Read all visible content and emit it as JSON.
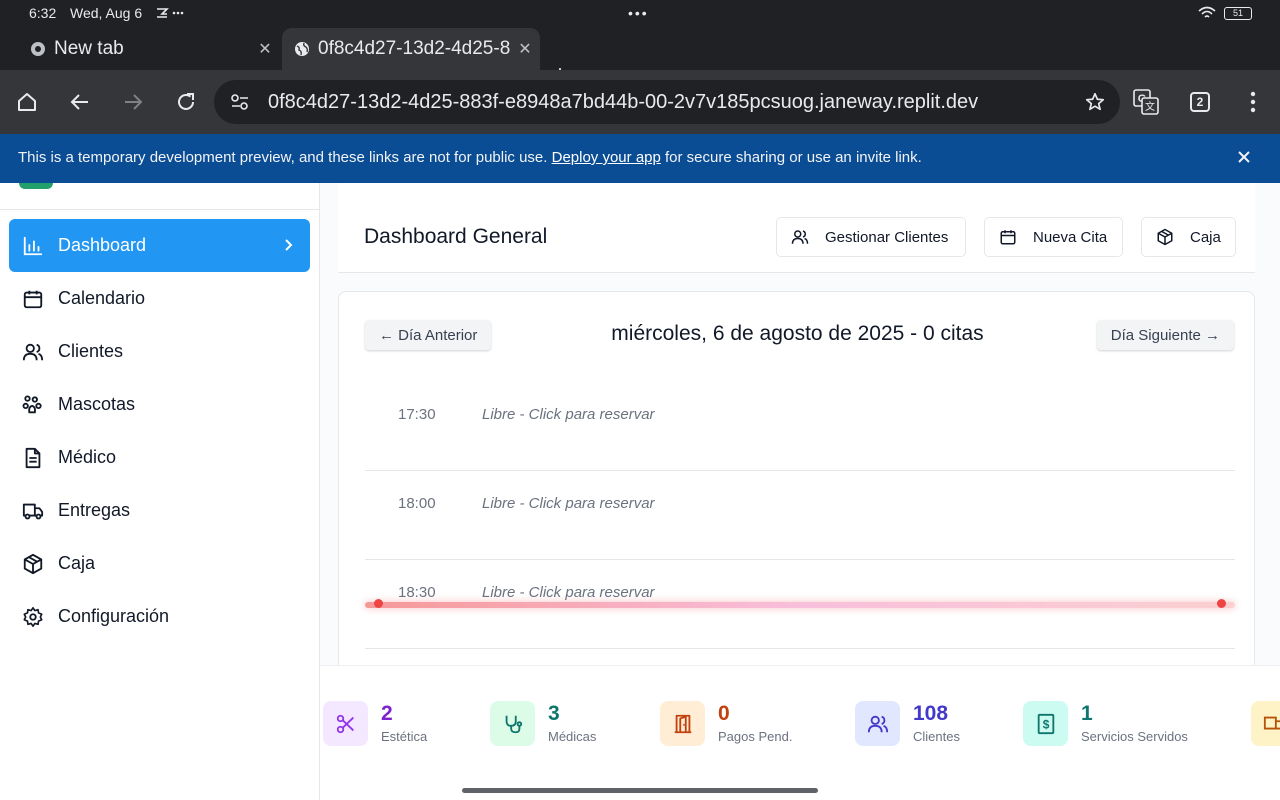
{
  "status_bar": {
    "time": "6:32",
    "date": "Wed, Aug 6",
    "center_indicator": "•••",
    "battery": "51"
  },
  "browser": {
    "tabs": [
      {
        "title": "New tab",
        "active": false
      },
      {
        "title": "0f8c4d27-13d2-4d25-883f-e8948a7bd44b",
        "active": true
      }
    ],
    "url": "0f8c4d27-13d2-4d25-883f-e8948a7bd44b-00-2v7v185pcsuog.janeway.replit.dev",
    "tab_count": "2"
  },
  "banner": {
    "text_before": "This is a temporary development preview, and these links are not for public use. ",
    "link": "Deploy your app",
    "text_after": " for secure sharing or use an invite link."
  },
  "sidebar": {
    "items": [
      {
        "label": "Dashboard",
        "icon": "bar-chart-icon",
        "active": true
      },
      {
        "label": "Calendario",
        "icon": "calendar-icon"
      },
      {
        "label": "Clientes",
        "icon": "users-icon"
      },
      {
        "label": "Mascotas",
        "icon": "paw-icon"
      },
      {
        "label": "Médico",
        "icon": "document-icon"
      },
      {
        "label": "Entregas",
        "icon": "truck-icon"
      },
      {
        "label": "Caja",
        "icon": "box-icon"
      },
      {
        "label": "Configuración",
        "icon": "gear-icon"
      }
    ]
  },
  "header": {
    "title": "Dashboard General",
    "buttons": {
      "clients": "Gestionar Clientes",
      "appointment": "Nueva Cita",
      "cash": "Caja"
    }
  },
  "calendar": {
    "prev": "← Día Anterior",
    "next": "Día Siguiente →",
    "title": "miércoles, 6 de agosto de 2025 - 0 citas",
    "slots": [
      {
        "time": "17:30",
        "text": "Libre - Click para reservar"
      },
      {
        "time": "18:00",
        "text": "Libre - Click para reservar"
      },
      {
        "time": "18:30",
        "text": "Libre - Click para reservar"
      }
    ]
  },
  "stats": [
    {
      "value": "2",
      "label": "Estética",
      "icon": "scissors-icon",
      "color": "#9333ea",
      "bg": "#f3e8ff"
    },
    {
      "value": "3",
      "label": "Médicas",
      "icon": "stethoscope-icon",
      "color": "#0f766e",
      "bg": "#dcfce7"
    },
    {
      "value": "0",
      "label": "Pagos Pend.",
      "icon": "door-icon",
      "color": "#c2410c",
      "bg": "#ffedd5"
    },
    {
      "value": "108",
      "label": "Clientes",
      "icon": "users-icon",
      "color": "#4338ca",
      "bg": "#e0e7ff"
    },
    {
      "value": "1",
      "label": "Servicios Servidos",
      "icon": "receipt-icon",
      "color": "#0f766e",
      "bg": "#ccfbf1"
    }
  ]
}
